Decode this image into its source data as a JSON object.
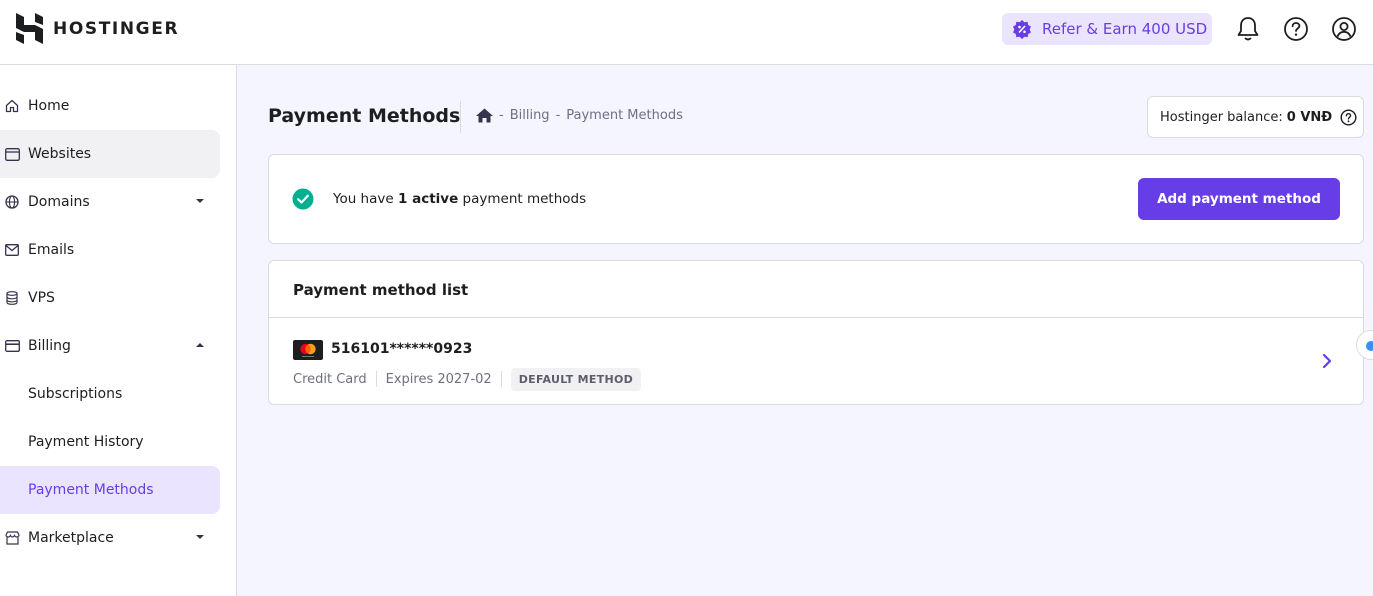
{
  "brand": {
    "name": "HOSTINGER"
  },
  "header": {
    "refer_label": "Refer & Earn 400 USD"
  },
  "sidebar": {
    "items": [
      {
        "label": "Home",
        "icon": "home-icon"
      },
      {
        "label": "Websites",
        "icon": "browser-window-icon"
      },
      {
        "label": "Domains",
        "icon": "globe-icon"
      },
      {
        "label": "Emails",
        "icon": "envelope-icon"
      },
      {
        "label": "VPS",
        "icon": "database-icon"
      },
      {
        "label": "Billing",
        "icon": "credit-card-icon"
      },
      {
        "label": "Subscriptions"
      },
      {
        "label": "Payment History"
      },
      {
        "label": "Payment Methods"
      },
      {
        "label": "Marketplace",
        "icon": "store-icon"
      }
    ]
  },
  "page": {
    "title": "Payment Methods",
    "breadcrumb": [
      "Billing",
      "Payment Methods"
    ],
    "breadcrumb_sep": "-",
    "balance_label": "Hostinger balance:",
    "balance_value": "0 VNĐ"
  },
  "status": {
    "prefix": "You have",
    "count_text": "1 active",
    "suffix": "payment methods",
    "add_button": "Add payment method"
  },
  "list": {
    "title": "Payment method list",
    "methods": [
      {
        "number": "516101******0923",
        "type": "Credit Card",
        "expires": "Expires 2027-02",
        "badge": "DEFAULT METHOD",
        "brand_icon": "mastercard-icon"
      }
    ]
  },
  "colors": {
    "accent": "#673de6",
    "accent_light": "#ebe4ff",
    "success": "#00b090",
    "border": "#dadce0",
    "page_bg": "#f4f5ff"
  }
}
